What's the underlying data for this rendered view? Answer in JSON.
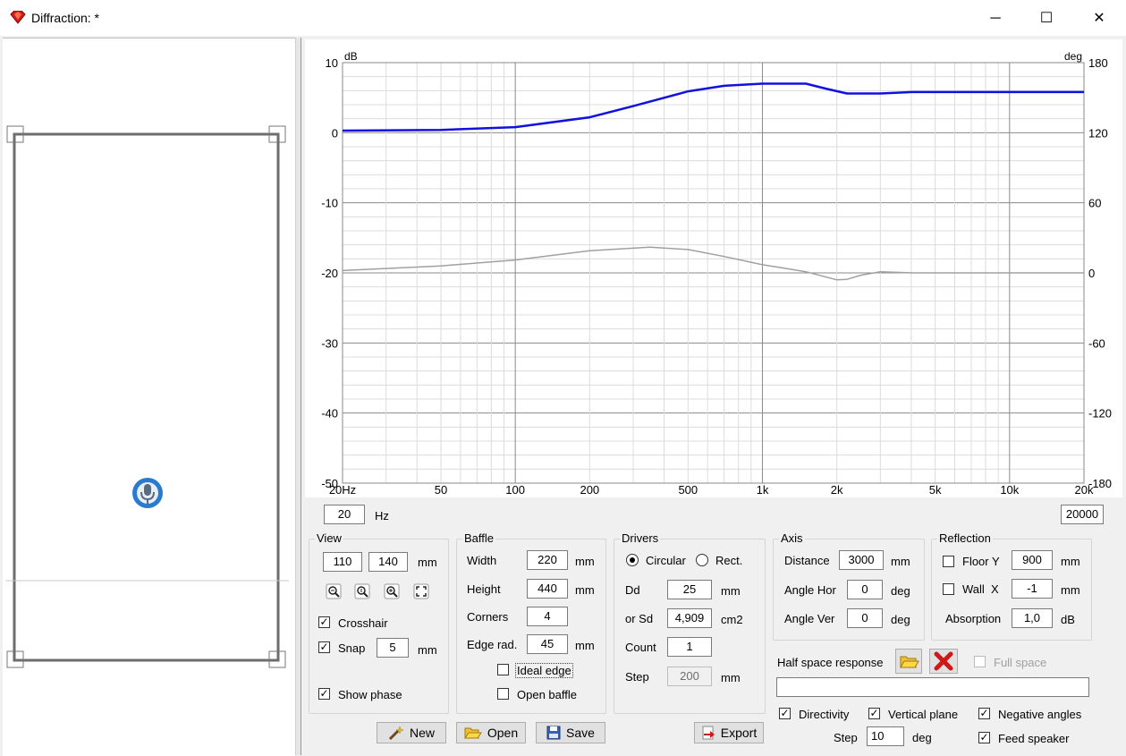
{
  "window": {
    "title": "Diffraction: *",
    "minimize": "─",
    "maximize": "☐",
    "close": "✕"
  },
  "chart_data": {
    "type": "line",
    "x_scale": "log",
    "xlim": [
      20,
      20000
    ],
    "y_left": {
      "label": "dB",
      "lim": [
        -50,
        10
      ],
      "ticks": [
        10,
        0,
        -10,
        -20,
        -30,
        -40,
        -50
      ]
    },
    "y_right": {
      "label": "deg",
      "lim": [
        -180,
        180
      ],
      "ticks": [
        180,
        120,
        60,
        0,
        -60,
        -120,
        -180
      ]
    },
    "x_tick_labels": [
      "20Hz",
      "50",
      "100",
      "200",
      "500",
      "1k",
      "2k",
      "5k",
      "10k",
      "20k"
    ],
    "x_tick_values": [
      20,
      50,
      100,
      200,
      500,
      1000,
      2000,
      5000,
      10000,
      20000
    ],
    "grid": true,
    "series": [
      {
        "axis": "left",
        "color": "#1010e0",
        "x": [
          20,
          50,
          100,
          200,
          300,
          500,
          700,
          1000,
          1500,
          1800,
          2200,
          3000,
          4000,
          5000,
          7000,
          10000,
          20000
        ],
        "y": [
          0.3,
          0.4,
          0.8,
          2.2,
          3.8,
          5.9,
          6.7,
          7.0,
          7.0,
          6.3,
          5.6,
          5.6,
          5.8,
          5.8,
          5.8,
          5.8,
          5.8
        ]
      },
      {
        "axis": "right",
        "color": "#a0a0a0",
        "x": [
          20,
          50,
          100,
          200,
          350,
          500,
          700,
          1000,
          1500,
          2000,
          2200,
          2500,
          3000,
          4000,
          5000,
          10000,
          20000
        ],
        "y": [
          2,
          6,
          11,
          19,
          22,
          20,
          14,
          7,
          1,
          -6,
          -5.5,
          -2,
          1,
          0,
          0,
          0,
          0
        ]
      }
    ]
  },
  "range": {
    "min": "20",
    "min_unit": "Hz",
    "max": "20000"
  },
  "view": {
    "label": "View",
    "w": "110",
    "h": "140",
    "unit": "mm",
    "crosshair": "Crosshair",
    "snap": "Snap",
    "snap_val": "5",
    "snap_unit": "mm",
    "show_phase": "Show phase"
  },
  "baffle": {
    "label": "Baffle",
    "width_l": "Width",
    "width": "220",
    "height_l": "Height",
    "height": "440",
    "corners_l": "Corners",
    "corners": "4",
    "edge_l": "Edge rad.",
    "edge": "45",
    "unit": "mm",
    "ideal": "Ideal edge",
    "open": "Open baffle"
  },
  "drivers": {
    "label": "Drivers",
    "circular": "Circular",
    "rect": "Rect.",
    "dd_l": "Dd",
    "dd": "25",
    "dd_unit": "mm",
    "sd_l": "or Sd",
    "sd": "4,909",
    "sd_unit": "cm2",
    "count_l": "Count",
    "count": "1",
    "step_l": "Step",
    "step": "200",
    "step_unit": "mm"
  },
  "axis": {
    "label": "Axis",
    "dist_l": "Distance",
    "dist": "3000",
    "dist_unit": "mm",
    "hor_l": "Angle Hor",
    "hor": "0",
    "ver_l": "Angle Ver",
    "ver": "0",
    "deg": "deg"
  },
  "reflection": {
    "label": "Reflection",
    "floor_l": "Floor Y",
    "floor": "900",
    "wall_l": "Wall  X",
    "wall": "-1",
    "unit": "mm",
    "abs_l": "Absorption",
    "abs": "1,0",
    "abs_unit": "dB"
  },
  "halfspace": {
    "label": "Half space response",
    "full": "Full space",
    "path": ""
  },
  "options": {
    "directivity": "Directivity",
    "vertical": "Vertical plane",
    "negative": "Negative angles",
    "step_l": "Step",
    "step": "10",
    "step_unit": "deg",
    "feed": "Feed speaker"
  },
  "buttons": {
    "new": "New",
    "open": "Open",
    "save": "Save",
    "export": "Export"
  },
  "icons": {
    "app": "gem-icon",
    "mic": "microphone-icon",
    "zoom_out": "zoom-out-icon",
    "zoom_fit": "zoom-fit-icon",
    "zoom_in": "zoom-in-icon",
    "fullscreen": "fullscreen-icon",
    "folder": "folder-icon",
    "delete": "delete-icon",
    "wand": "wand-icon",
    "disk": "disk-icon"
  }
}
